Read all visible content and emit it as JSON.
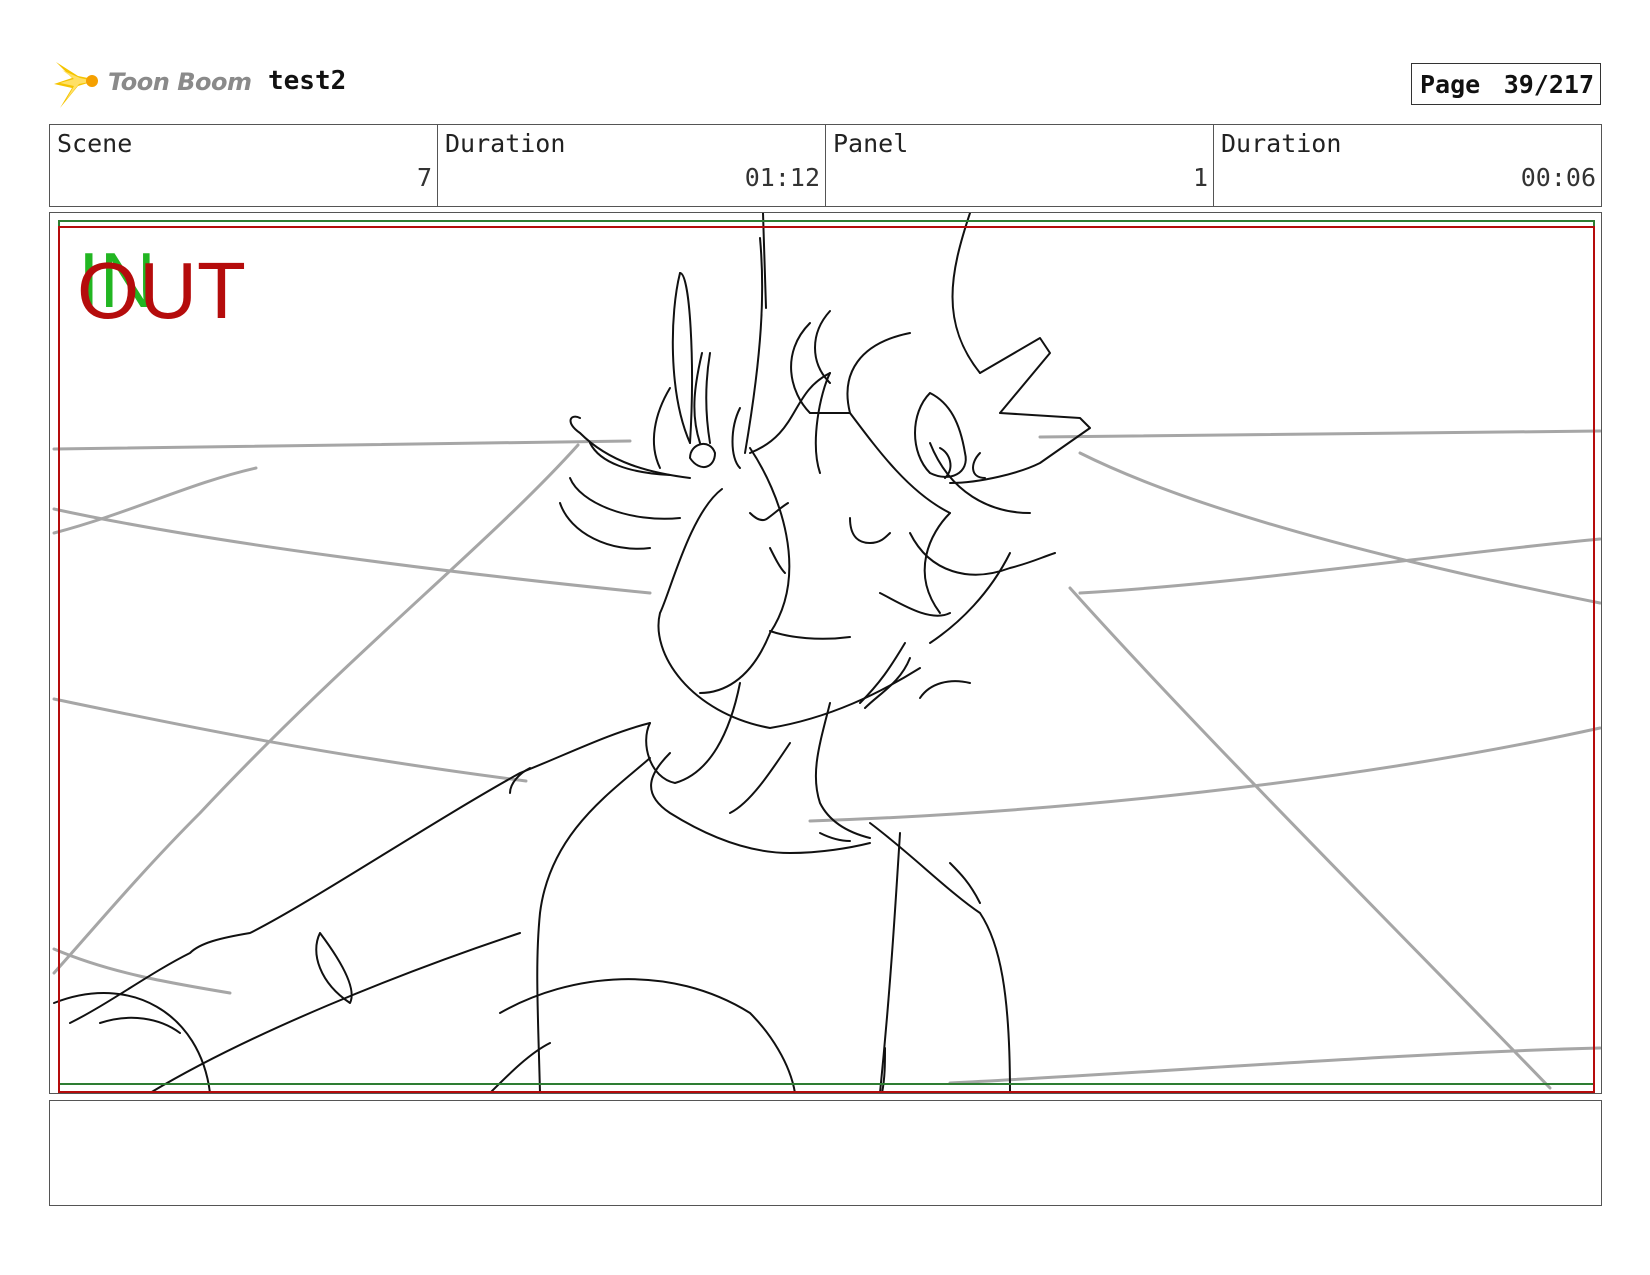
{
  "header": {
    "logo_icon": "toon-boom-star-icon",
    "logo_text": "Toon Boom",
    "project_title": "test2",
    "page_label": "Page",
    "page_value": "39/217"
  },
  "info": {
    "scene_label": "Scene",
    "scene_value": "7",
    "scene_duration_label": "Duration",
    "scene_duration_value": "01:12",
    "panel_label": "Panel",
    "panel_value": "1",
    "panel_duration_label": "Duration",
    "panel_duration_value": "00:06"
  },
  "panel": {
    "in_marker": "IN",
    "out_marker": "OUT",
    "colors": {
      "safe_frame": "#b50c0c",
      "action_frame": "#2e7d32",
      "background_lines": "#a6a6a6",
      "sketch": "#111111"
    }
  },
  "notes": {
    "text": ""
  }
}
